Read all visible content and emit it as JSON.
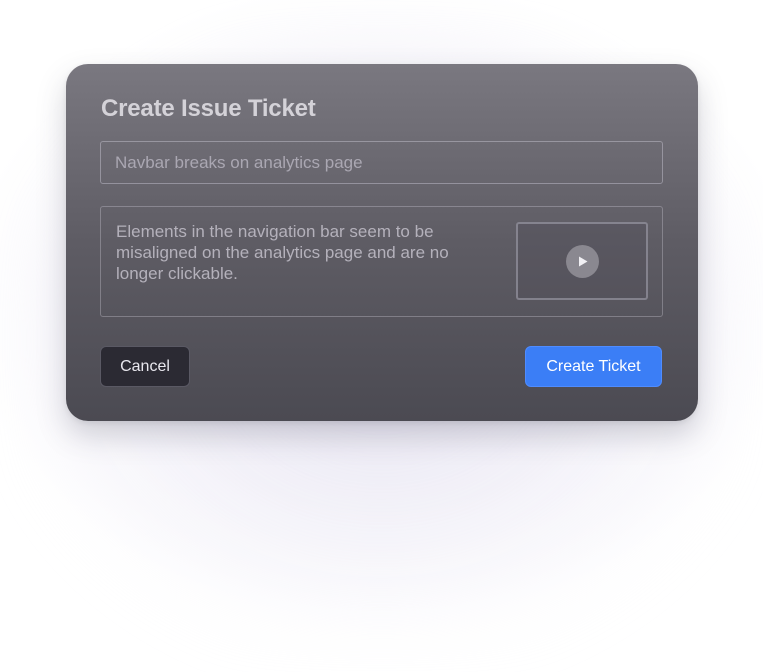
{
  "modal": {
    "title": "Create Issue Ticket",
    "title_field": {
      "value": "Navbar breaks on analytics page"
    },
    "description": {
      "text": "Elements in the navigation bar seem to be misaligned on the analytics page and are no longer clickable."
    },
    "attachment": {
      "icon": "play-icon"
    },
    "actions": {
      "cancel_label": "Cancel",
      "create_label": "Create Ticket"
    }
  },
  "colors": {
    "primary_button": "#3b7ef6",
    "secondary_button": "#2b2a33",
    "modal_top": "#7a7880",
    "modal_bottom": "#4b4a52"
  }
}
